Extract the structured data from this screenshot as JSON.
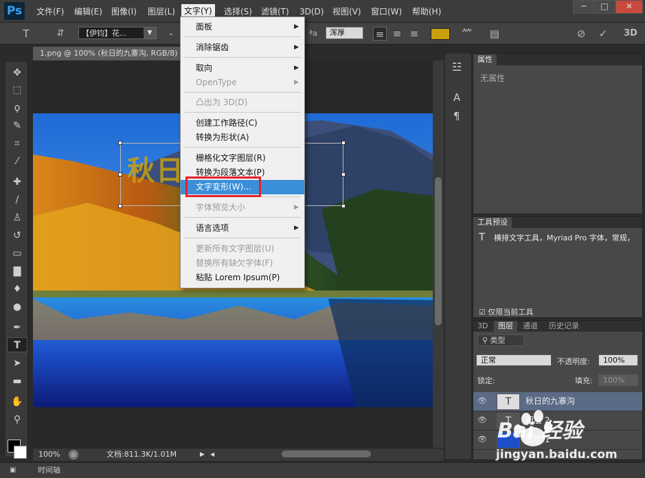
{
  "app": {
    "logo": "Ps"
  },
  "menubar": {
    "items": [
      "文件(F)",
      "编辑(E)",
      "图像(I)",
      "图层(L)",
      "文字(Y)",
      "选择(S)",
      "滤镜(T)",
      "3D(D)",
      "视图(V)",
      "窗口(W)",
      "帮助(H)"
    ]
  },
  "window_controls": {
    "minimize": "─",
    "maximize": "□",
    "close": "✕"
  },
  "options_bar": {
    "tool_glyph": "T",
    "font_family": "【伊钧】花...",
    "size_dash": "-",
    "aa_label": "ªa",
    "antialias": "浑厚",
    "ok": "✓",
    "cancel": "⊘",
    "threed": "3D",
    "text_color": "#c9a10f"
  },
  "document": {
    "tab_title": "1.png @ 100% (秋日的九寨沟, RGB/8)",
    "canvas_text": "秋日的九寨沟"
  },
  "text_menu": {
    "items": [
      {
        "label": "面板",
        "disabled": false,
        "submenu": true
      },
      {
        "label": "消除锯齿",
        "disabled": false,
        "submenu": true
      },
      {
        "label": "取向",
        "disabled": false,
        "submenu": true
      },
      {
        "label": "OpenType",
        "disabled": true,
        "submenu": true
      },
      {
        "label": "凸出为 3D(D)",
        "disabled": true,
        "submenu": false
      },
      {
        "label": "创建工作路径(C)",
        "disabled": false,
        "submenu": false
      },
      {
        "label": "转换为形状(A)",
        "disabled": false,
        "submenu": false
      },
      {
        "label": "栅格化文字图层(R)",
        "disabled": false,
        "submenu": false
      },
      {
        "label": "转换为段落文本(P)",
        "disabled": false,
        "submenu": false
      },
      {
        "label": "文字变形(W)...",
        "disabled": false,
        "submenu": false,
        "highlighted": true
      },
      {
        "label": "字体预览大小",
        "disabled": true,
        "submenu": true
      },
      {
        "label": "语言选项",
        "disabled": false,
        "submenu": true
      },
      {
        "label": "更新所有文字图层(U)",
        "disabled": true,
        "submenu": false
      },
      {
        "label": "替换所有缺欠字体(F)",
        "disabled": true,
        "submenu": false
      },
      {
        "label": "粘贴 Lorem Ipsum(P)",
        "disabled": false,
        "submenu": false
      }
    ]
  },
  "statusbar": {
    "zoom": "100%",
    "doc_info": "文档:811.3K/1.01M"
  },
  "timeline": {
    "label": "时间轴"
  },
  "properties_panel": {
    "tab": "属性",
    "content": "无属性"
  },
  "tool_presets_panel": {
    "tab": "工具预设",
    "item": "横排文字工具，Myriad Pro 字体，常规，",
    "checkbox_label": "仅限当前工具"
  },
  "layers_panel": {
    "tabs": [
      "3D",
      "图层",
      "通道",
      "历史记录"
    ],
    "filter": "类型",
    "blend_mode": "正常",
    "opacity_label": "不透明度:",
    "opacity": "100%",
    "lock_label": "锁定:",
    "fill_label": "填充:",
    "fill": "100%",
    "layers": [
      {
        "name": "秋日的九寨沟",
        "type": "text",
        "selected": true
      },
      {
        "name": "图层 2",
        "type": "text",
        "selected": false
      },
      {
        "name": "图层 1",
        "type": "image",
        "selected": false
      }
    ]
  },
  "watermark": {
    "text": "Bai 经验",
    "url": "jingyan.baidu.com"
  }
}
